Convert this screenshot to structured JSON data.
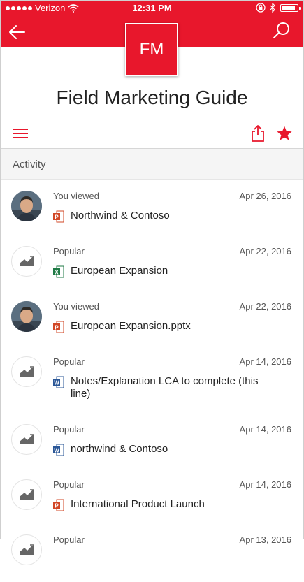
{
  "status_bar": {
    "carrier": "Verizon",
    "time": "12:31 PM",
    "battery_level": 0.85
  },
  "header": {
    "tile_initials": "FM",
    "site_title": "Field Marketing Guide",
    "brand_color": "#e8172c",
    "icons": [
      "back-arrow-icon",
      "search-icon",
      "hamburger-menu-icon",
      "share-icon",
      "star-icon"
    ]
  },
  "section": {
    "label": "Activity"
  },
  "activity": [
    {
      "avatar": "photo",
      "kind": "You viewed",
      "date": "Apr 26, 2016",
      "file_type": "powerpoint",
      "title": "Northwind & Contoso"
    },
    {
      "avatar": "trend",
      "kind": "Popular",
      "date": "Apr 22, 2016",
      "file_type": "excel",
      "title": "European Expansion"
    },
    {
      "avatar": "photo",
      "kind": "You viewed",
      "date": "Apr 22, 2016",
      "file_type": "powerpoint",
      "title": "European Expansion.pptx"
    },
    {
      "avatar": "trend",
      "kind": "Popular",
      "date": "Apr 14, 2016",
      "file_type": "word",
      "title": "Notes/Explanation LCA to complete (this line)"
    },
    {
      "avatar": "trend",
      "kind": "Popular",
      "date": "Apr 14, 2016",
      "file_type": "word",
      "title": "northwind & Contoso"
    },
    {
      "avatar": "trend",
      "kind": "Popular",
      "date": "Apr 14, 2016",
      "file_type": "powerpoint",
      "title": "International Product Launch"
    },
    {
      "avatar": "trend",
      "kind": "Popular",
      "date": "Apr 13, 2016",
      "file_type": "",
      "title": ""
    }
  ]
}
